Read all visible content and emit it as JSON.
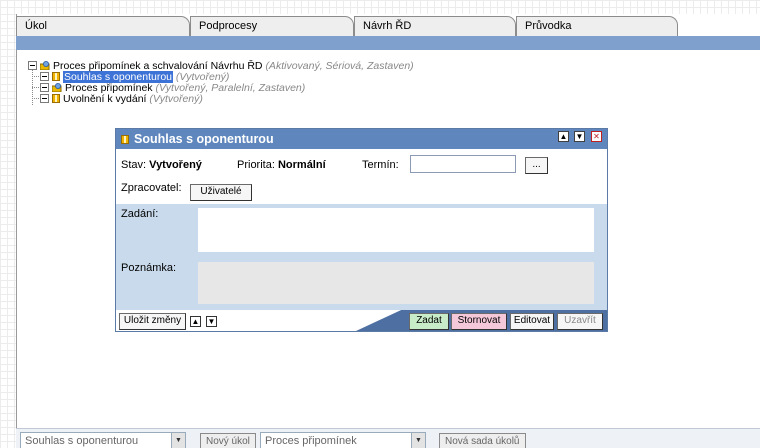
{
  "tabs": [
    {
      "label": "Úkol"
    },
    {
      "label": "Podprocesy"
    },
    {
      "label": "Návrh ŘD"
    },
    {
      "label": "Průvodka"
    }
  ],
  "tree": {
    "root": {
      "label": "Proces připomínek a schvalování Návrhu ŘD",
      "status": "(Aktivovaný, Sériová, Zastaven)"
    },
    "children": [
      {
        "label": "Souhlas s oponenturou",
        "status": "(Vytvořený)",
        "selected": true,
        "icon": "task-icon"
      },
      {
        "label": "Proces připomínek",
        "status": "(Vytvořený, Paralelní, Zastaven)",
        "icon": "gear-icon"
      },
      {
        "label": "Uvolnění k vydání",
        "status": "(Vytvořený)",
        "icon": "task-icon"
      }
    ]
  },
  "dialog": {
    "title": "Souhlas s oponenturou",
    "stav_label": "Stav:",
    "stav_value": "Vytvořený",
    "priorita_label": "Priorita:",
    "priorita_value": "Normální",
    "termin_label": "Termín:",
    "termin_value": "",
    "browse_label": "...",
    "zpracovatel_label": "Zpracovatel:",
    "uzivatele_label": "Uživatelé",
    "zadani_label": "Zadání:",
    "zadani_value": "",
    "poznamka_label": "Poznámka:",
    "poznamka_value": "",
    "save_label": "Uložit změny",
    "zadat_label": "Zadat",
    "stornovat_label": "Stornovat",
    "editovat_label": "Editovat",
    "uzavrit_label": "Uzavřít",
    "colors": {
      "title": "#5f86bd",
      "zadat": "#c8ecc8",
      "stornovat": "#f4c8d8"
    }
  },
  "statusbar": {
    "task_combo_value": "Souhlas s oponenturou",
    "new_task_label": "Nový úkol",
    "process_combo_value": "Proces připomínek",
    "new_set_label": "Nová sada úkolů"
  }
}
